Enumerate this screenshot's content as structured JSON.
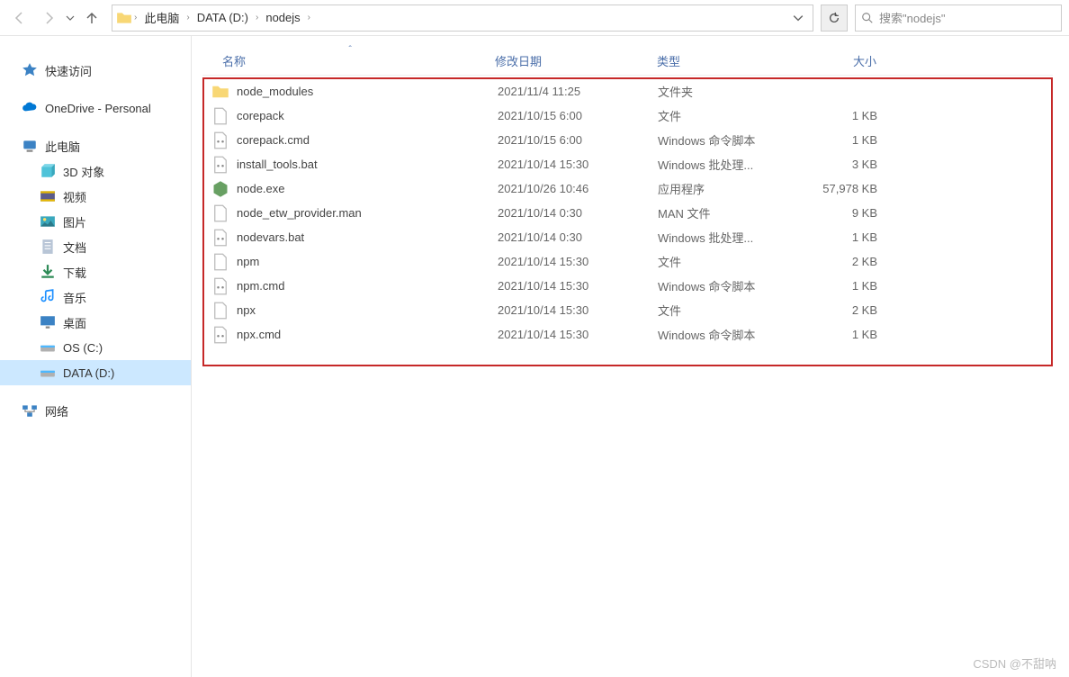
{
  "toolbar": {
    "breadcrumbs": [
      "此电脑",
      "DATA (D:)",
      "nodejs"
    ],
    "search_placeholder": "搜索\"nodejs\""
  },
  "sidebar": {
    "quick_access": "快速访问",
    "onedrive": "OneDrive - Personal",
    "this_pc": "此电脑",
    "pc_children": [
      {
        "label": "3D 对象",
        "icon": "3d"
      },
      {
        "label": "视频",
        "icon": "video"
      },
      {
        "label": "图片",
        "icon": "pictures"
      },
      {
        "label": "文档",
        "icon": "documents"
      },
      {
        "label": "下载",
        "icon": "downloads"
      },
      {
        "label": "音乐",
        "icon": "music"
      },
      {
        "label": "桌面",
        "icon": "desktop"
      },
      {
        "label": "OS (C:)",
        "icon": "drive"
      },
      {
        "label": "DATA (D:)",
        "icon": "drive",
        "selected": true
      }
    ],
    "network": "网络"
  },
  "columns": {
    "name": "名称",
    "date": "修改日期",
    "type": "类型",
    "size": "大小"
  },
  "files": [
    {
      "icon": "folder",
      "name": "node_modules",
      "date": "2021/11/4 11:25",
      "type": "文件夹",
      "size": ""
    },
    {
      "icon": "file",
      "name": "corepack",
      "date": "2021/10/15 6:00",
      "type": "文件",
      "size": "1 KB"
    },
    {
      "icon": "cmd",
      "name": "corepack.cmd",
      "date": "2021/10/15 6:00",
      "type": "Windows 命令脚本",
      "size": "1 KB"
    },
    {
      "icon": "bat",
      "name": "install_tools.bat",
      "date": "2021/10/14 15:30",
      "type": "Windows 批处理...",
      "size": "3 KB"
    },
    {
      "icon": "node",
      "name": "node.exe",
      "date": "2021/10/26 10:46",
      "type": "应用程序",
      "size": "57,978 KB"
    },
    {
      "icon": "file",
      "name": "node_etw_provider.man",
      "date": "2021/10/14 0:30",
      "type": "MAN 文件",
      "size": "9 KB"
    },
    {
      "icon": "bat",
      "name": "nodevars.bat",
      "date": "2021/10/14 0:30",
      "type": "Windows 批处理...",
      "size": "1 KB"
    },
    {
      "icon": "file",
      "name": "npm",
      "date": "2021/10/14 15:30",
      "type": "文件",
      "size": "2 KB"
    },
    {
      "icon": "cmd",
      "name": "npm.cmd",
      "date": "2021/10/14 15:30",
      "type": "Windows 命令脚本",
      "size": "1 KB"
    },
    {
      "icon": "file",
      "name": "npx",
      "date": "2021/10/14 15:30",
      "type": "文件",
      "size": "2 KB"
    },
    {
      "icon": "cmd",
      "name": "npx.cmd",
      "date": "2021/10/14 15:30",
      "type": "Windows 命令脚本",
      "size": "1 KB"
    }
  ],
  "watermark": "CSDN @不甜呐"
}
